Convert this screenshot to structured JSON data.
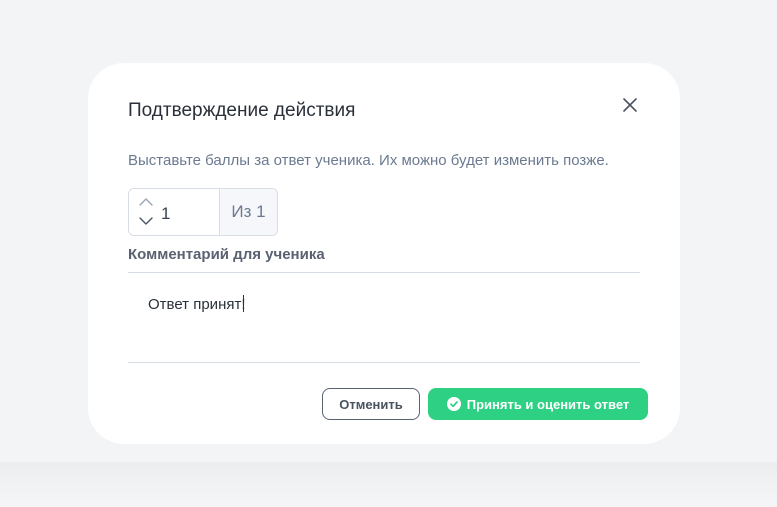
{
  "dialog": {
    "title": "Подтверждение действия",
    "description": "Выставьте баллы за ответ ученика. Их можно будет изменить позже.",
    "score": {
      "value": "1",
      "max_label": "Из 1"
    },
    "comment": {
      "label": "Комментарий для ученика",
      "value": "Ответ принят!"
    },
    "buttons": {
      "cancel": "Отменить",
      "accept": "Принять и оценить ответ"
    },
    "icons": {
      "close": "close-icon",
      "up": "chevron-up-icon",
      "down": "chevron-down-icon",
      "accept": "check-circle-icon"
    },
    "colors": {
      "accent": "#2ed184",
      "text": "#2a3039",
      "muted": "#6b7a90"
    }
  }
}
